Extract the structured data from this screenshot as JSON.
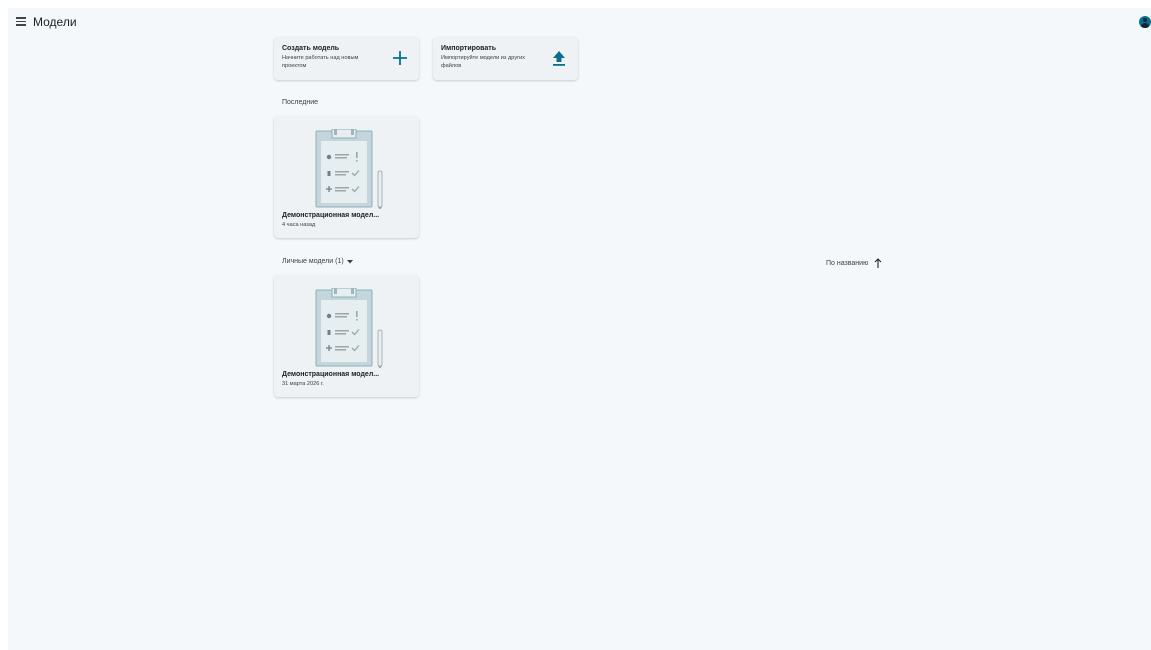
{
  "header": {
    "menu_icon": "menu-icon",
    "title": "Модели",
    "account_icon": "account-icon"
  },
  "actions": {
    "create": {
      "title": "Создать модель",
      "description": "Начните работать над новым проектом",
      "icon": "plus-icon"
    },
    "import": {
      "title": "Импортировать",
      "description": "Импортируйте модели из других файлов",
      "icon": "upload-icon"
    }
  },
  "recent": {
    "label": "Последние",
    "items": [
      {
        "name": "Демонстрационная модел...",
        "date": "4 часа назад"
      }
    ]
  },
  "personal": {
    "filter_label": "Личные модели (1)",
    "sort_label": "По названию",
    "items": [
      {
        "name": "Демонстрационная модел...",
        "date": "31 марта 2026 г."
      }
    ]
  },
  "colors": {
    "accent": "#0a6f8f",
    "background": "#f4f8fa",
    "card": "#eef2f4"
  }
}
